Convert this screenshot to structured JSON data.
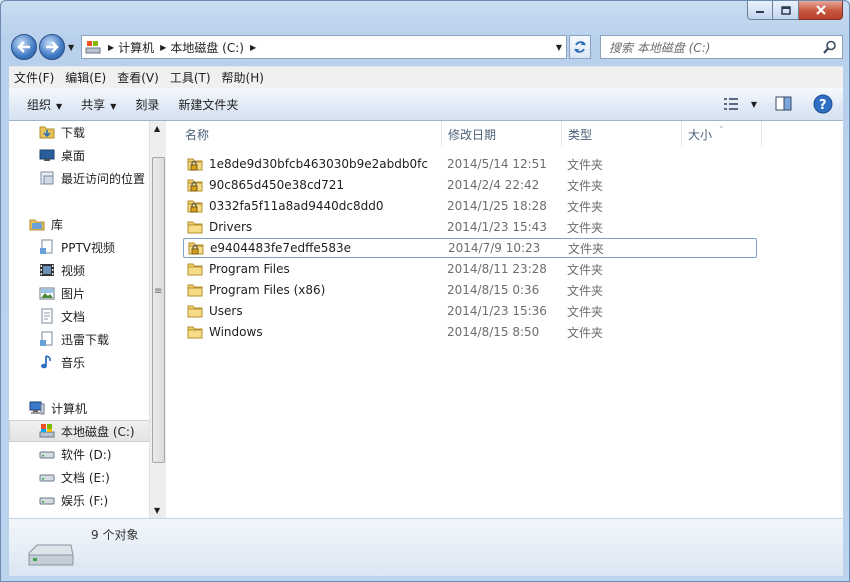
{
  "window": {
    "title_bar": {
      "minimize": "minimize",
      "maximize": "maximize",
      "close": "close"
    }
  },
  "nav": {
    "back_icon": "arrow-left-icon",
    "forward_icon": "arrow-right-icon",
    "breadcrumb": [
      "计算机",
      "本地磁盘 (C:)"
    ],
    "search_placeholder": "搜索 本地磁盘 (C:)"
  },
  "menu": [
    "文件(F)",
    "编辑(E)",
    "查看(V)",
    "工具(T)",
    "帮助(H)"
  ],
  "toolbar": {
    "organize": "组织",
    "share": "共享",
    "burn": "刻录",
    "new_folder": "新建文件夹"
  },
  "tree": [
    {
      "label": "下载",
      "icon": "download-folder-icon"
    },
    {
      "label": "桌面",
      "icon": "desktop-icon"
    },
    {
      "label": "最近访问的位置",
      "icon": "recent-places-icon"
    },
    {
      "label": "库",
      "icon": "library-icon"
    },
    {
      "label": "PPTV视频",
      "icon": "library-item-icon"
    },
    {
      "label": "视频",
      "icon": "video-library-icon"
    },
    {
      "label": "图片",
      "icon": "pictures-library-icon"
    },
    {
      "label": "文档",
      "icon": "documents-library-icon"
    },
    {
      "label": "迅雷下载",
      "icon": "library-item-icon"
    },
    {
      "label": "音乐",
      "icon": "music-library-icon"
    },
    {
      "label": "计算机",
      "icon": "computer-icon"
    },
    {
      "label": "本地磁盘 (C:)",
      "icon": "system-drive-icon"
    },
    {
      "label": "软件 (D:)",
      "icon": "drive-icon"
    },
    {
      "label": "文档 (E:)",
      "icon": "drive-icon"
    },
    {
      "label": "娱乐 (F:)",
      "icon": "drive-icon"
    }
  ],
  "columns": {
    "name": "名称",
    "date": "修改日期",
    "type": "类型",
    "size": "大小"
  },
  "files": [
    {
      "name": "1e8de9d30bfcb463030b9e2abdb0fc",
      "date": "2014/5/14 12:51",
      "type": "文件夹",
      "locked": true
    },
    {
      "name": "90c865d450e38cd721",
      "date": "2014/2/4 22:42",
      "type": "文件夹",
      "locked": true
    },
    {
      "name": "0332fa5f11a8ad9440dc8dd0",
      "date": "2014/1/25 18:28",
      "type": "文件夹",
      "locked": true
    },
    {
      "name": "Drivers",
      "date": "2014/1/23 15:43",
      "type": "文件夹",
      "locked": false
    },
    {
      "name": "e9404483fe7edffe583e",
      "date": "2014/7/9 10:23",
      "type": "文件夹",
      "locked": true
    },
    {
      "name": "Program Files",
      "date": "2014/8/11 23:28",
      "type": "文件夹",
      "locked": false
    },
    {
      "name": "Program Files (x86)",
      "date": "2014/8/15 0:36",
      "type": "文件夹",
      "locked": false
    },
    {
      "name": "Users",
      "date": "2014/1/23 15:36",
      "type": "文件夹",
      "locked": false
    },
    {
      "name": "Windows",
      "date": "2014/8/15 8:50",
      "type": "文件夹",
      "locked": false
    }
  ],
  "status": {
    "count": "9 个对象"
  }
}
